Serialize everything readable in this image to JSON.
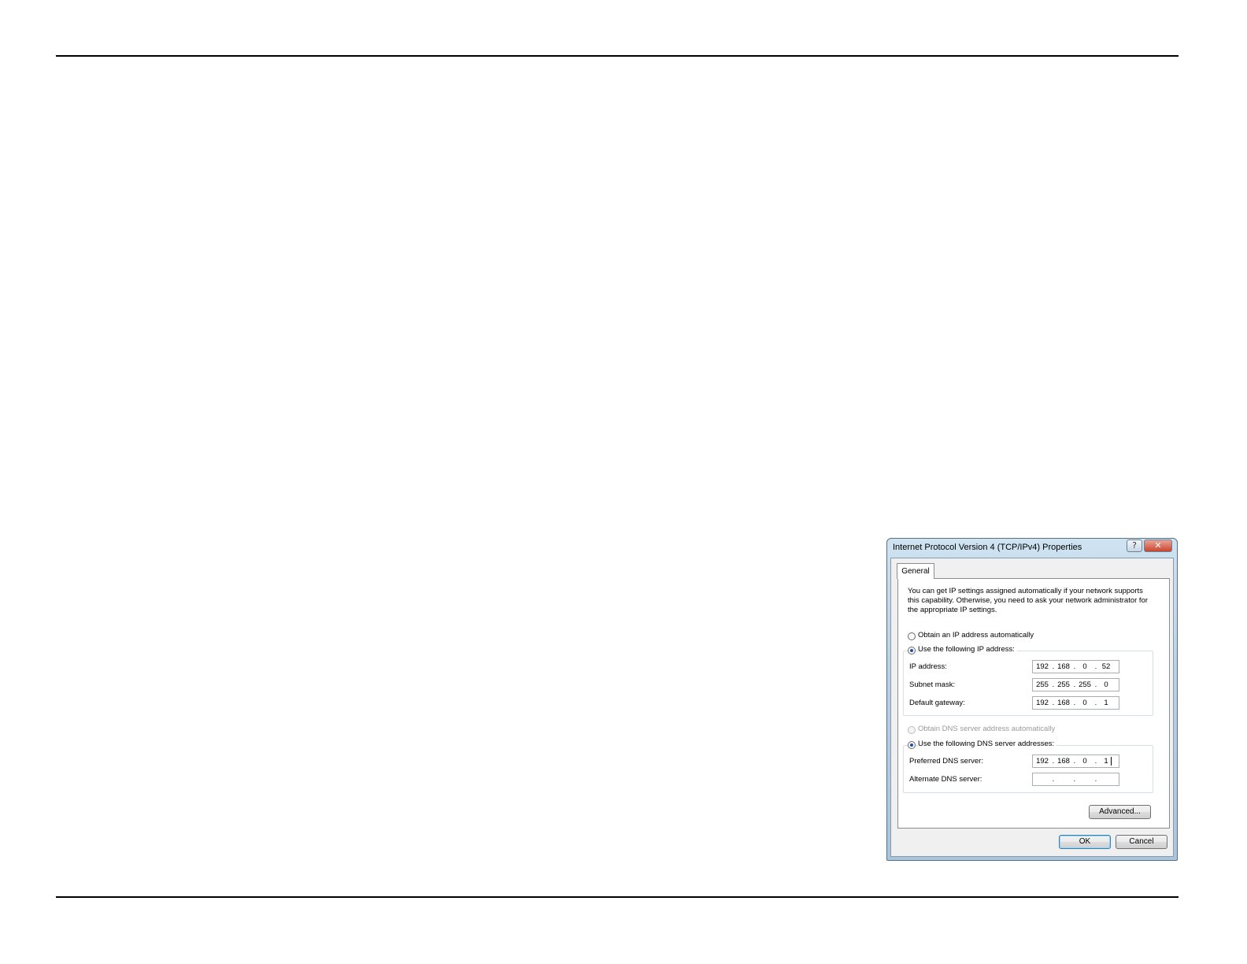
{
  "dialog": {
    "title": "Internet Protocol Version 4 (TCP/IPv4) Properties",
    "help_glyph": "?",
    "close_glyph": "✕",
    "tab_general": "General",
    "description": "You can get IP settings assigned automatically if your network supports this capability. Otherwise, you need to ask your network administrator for the appropriate IP settings.",
    "ip_auto_label": "Obtain an IP address automatically",
    "ip_manual_label": "Use the following IP address:",
    "ip_mode": "manual",
    "ip_address_label": "IP address:",
    "subnet_label": "Subnet mask:",
    "gateway_label": "Default gateway:",
    "ip_address": [
      "192",
      "168",
      "0",
      "52"
    ],
    "subnet_mask": [
      "255",
      "255",
      "255",
      "0"
    ],
    "default_gateway": [
      "192",
      "168",
      "0",
      "1"
    ],
    "dns_auto_label": "Obtain DNS server address automatically",
    "dns_manual_label": "Use the following DNS server addresses:",
    "dns_mode": "manual",
    "preferred_dns_label": "Preferred DNS server:",
    "alternate_dns_label": "Alternate DNS server:",
    "preferred_dns": [
      "192",
      "168",
      "0",
      "1"
    ],
    "alternate_dns": [
      "",
      "",
      "",
      ""
    ],
    "advanced_label": "Advanced...",
    "ok_label": "OK",
    "cancel_label": "Cancel"
  },
  "colors": {
    "title_bar": "#b9d3e6",
    "close_button": "#c9452d",
    "radio_dot": "#1f4f97"
  }
}
